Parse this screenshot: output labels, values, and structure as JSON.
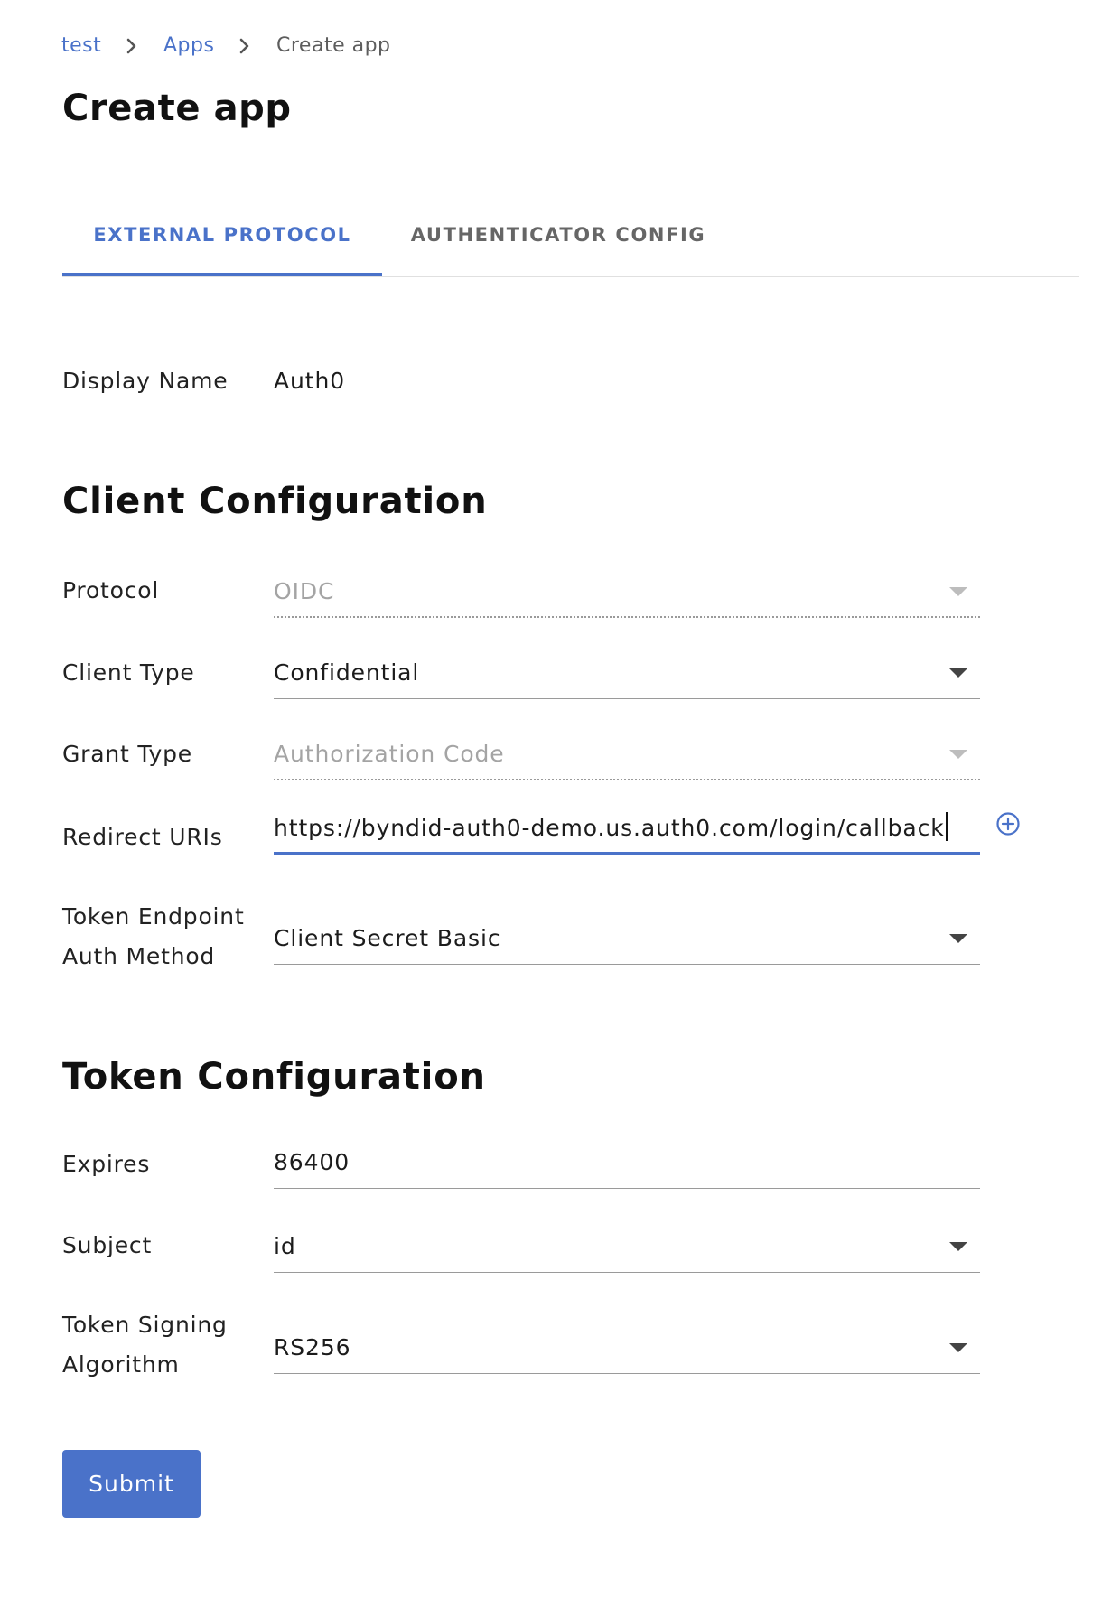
{
  "breadcrumb": {
    "items": [
      "test",
      "Apps"
    ],
    "current": "Create app"
  },
  "page": {
    "title": "Create app"
  },
  "tabs": [
    {
      "label": "EXTERNAL PROTOCOL",
      "active": true
    },
    {
      "label": "AUTHENTICATOR CONFIG",
      "active": false
    }
  ],
  "display_name": {
    "label": "Display Name",
    "value": "Auth0"
  },
  "client_config": {
    "title": "Client Configuration",
    "protocol": {
      "label": "Protocol",
      "value": "OIDC",
      "disabled": true
    },
    "client_type": {
      "label": "Client Type",
      "value": "Confidential"
    },
    "grant_type": {
      "label": "Grant Type",
      "value": "Authorization Code",
      "disabled": true
    },
    "redirect_uris": {
      "label": "Redirect URIs",
      "value": "https://byndid-auth0-demo.us.auth0.com/login/callback",
      "add_icon": "add-circle-icon"
    },
    "token_endpoint_auth": {
      "label_line1": "Token Endpoint",
      "label_line2": "Auth Method",
      "value": "Client Secret Basic"
    }
  },
  "token_config": {
    "title": "Token Configuration",
    "expires": {
      "label": "Expires",
      "value": "86400"
    },
    "subject": {
      "label": "Subject",
      "value": "id"
    },
    "signing_alg": {
      "label_line1": "Token Signing",
      "label_line2": "Algorithm",
      "value": "RS256"
    }
  },
  "submit": {
    "label": "Submit"
  },
  "colors": {
    "accent": "#4a72c9",
    "disabled_text": "#a4a4a4",
    "underline": "#9a9a9a",
    "tab_inactive": "#666666"
  }
}
